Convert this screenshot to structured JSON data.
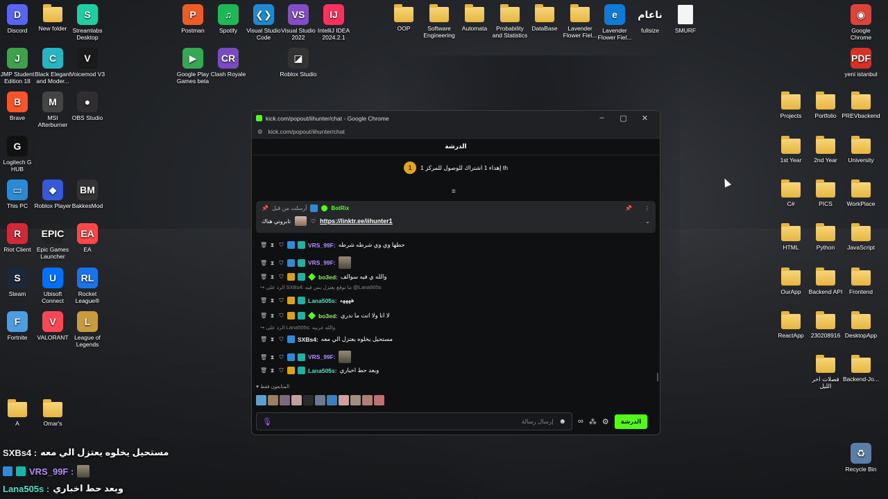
{
  "window": {
    "title": "kick.com/popout/iihunter/chat - Google Chrome",
    "url": "kick.com/popout/iihunter/chat",
    "controls": [
      "–",
      "▢",
      "✕"
    ]
  },
  "chat": {
    "header": "الدرشة",
    "goal_rank": "1",
    "goal_text": "إهداء 1 اشتراك للوصول للمركز 1 th",
    "pinned": {
      "meta": "أرسلت من قبل",
      "bot": "BotRix",
      "link": "https://linktr.ee/iihunter1",
      "label": "تابروني هناك"
    },
    "messages": [
      {
        "user": "VRS_99F:",
        "text": "حطها وي وي شرطه شرطه",
        "color": "purple"
      },
      {
        "user": "VRS_99F:",
        "text": "",
        "color": "purple"
      },
      {
        "user": "bo3ed:",
        "text": "والله ي فيه سوالف",
        "color": "green"
      },
      {
        "user": "Lana505s:",
        "text": "ههههه",
        "color": "teal"
      },
      {
        "user": "bo3ed:",
        "text": "لا انا ولا انت ما ندري",
        "color": "green"
      },
      {
        "user": "SXBs4:",
        "text": "مستحيل يخلوه يعتزل الي معه",
        "color": "white"
      },
      {
        "user": "VRS_99F:",
        "text": "",
        "color": "purple"
      },
      {
        "user": "Lana505s:",
        "text": "وبعد حط اخباري",
        "color": "teal"
      }
    ],
    "replies": [
      "الرد على SXBs4: ما توقع يعتزل بس فيه @Lana505s",
      "الرد على Lana505s: والله عربيه"
    ],
    "viewers_label": "المتابعون فقط",
    "input_placeholder": "إرسال رسالة",
    "send_label": "الدرشة"
  },
  "overlay": [
    {
      "user": "SXBs4 :",
      "text": "مستحيل يخلوه يعتزل الي معه"
    },
    {
      "user": "VRS_99F :",
      "text": ""
    },
    {
      "user": "Lana505s :",
      "text": "وبعد حط اخباري"
    }
  ],
  "desktop": {
    "icons": [
      {
        "label": "Discord",
        "color": "#5865f2",
        "glyph": "D"
      },
      {
        "label": "New folder",
        "type": "folder"
      },
      {
        "label": "Streamlabs Desktop",
        "color": "#1fcfa1",
        "glyph": "S"
      },
      {
        "label": "Postman",
        "color": "#ef5b25",
        "glyph": "P"
      },
      {
        "label": "Spotify",
        "color": "#1db954",
        "glyph": "♫"
      },
      {
        "label": "Visual Studio Code",
        "color": "#1f8ad2",
        "glyph": "❮❯"
      },
      {
        "label": "Visual Studio 2022",
        "color": "#854cc7",
        "glyph": "VS"
      },
      {
        "label": "IntelliJ IDEA 2024.2.1",
        "color": "#fe315d",
        "glyph": "IJ"
      },
      {
        "label": "OOP",
        "type": "folder"
      },
      {
        "label": "Software Engineering",
        "type": "folder"
      },
      {
        "label": "Automata",
        "type": "folder"
      },
      {
        "label": "Probability and Statistics",
        "type": "folder"
      },
      {
        "label": "DataBase",
        "type": "folder"
      },
      {
        "label": "Lavender Flower Fiel...",
        "type": "folder"
      },
      {
        "label": "Lavender Flower Fiel...",
        "color": "#0f7bd8",
        "glyph": "e"
      },
      {
        "label": "fullsize",
        "color": "transparent",
        "glyph": "ناعام"
      },
      {
        "label": "SMURF",
        "type": "doc"
      },
      {
        "label": "Google Chrome",
        "color": "#db4437",
        "glyph": "◉"
      },
      {
        "label": "JMP Student Edition 18",
        "color": "#3fa14b",
        "glyph": "J"
      },
      {
        "label": "Black Elegant and Moder...",
        "color": "#26b5c2",
        "glyph": "C"
      },
      {
        "label": "Voicemod V3",
        "color": "#1a1a1a",
        "glyph": "V"
      },
      {
        "label": "Google Play Games beta",
        "color": "#34a853",
        "glyph": "▶"
      },
      {
        "label": "Clash Royale",
        "color": "#7a4ac2",
        "glyph": "CR"
      },
      {
        "label": "Roblox Studio",
        "color": "#333",
        "glyph": "◪"
      },
      {
        "label": "yeni istanbul",
        "color": "#d93025",
        "glyph": "PDF"
      },
      {
        "label": "Brave",
        "color": "#fb542b",
        "glyph": "B"
      },
      {
        "label": "MSI Afterburner",
        "color": "#444",
        "glyph": "M"
      },
      {
        "label": "OBS Studio",
        "color": "#302e31",
        "glyph": "●"
      },
      {
        "label": "Projects",
        "type": "folder"
      },
      {
        "label": "Portfolio",
        "type": "folder"
      },
      {
        "label": "PREVbackend",
        "type": "folder"
      },
      {
        "label": "Logitech G HUB",
        "color": "#111",
        "glyph": "G"
      },
      {
        "label": "1st Year",
        "type": "folder"
      },
      {
        "label": "2nd Year",
        "type": "folder"
      },
      {
        "label": "University",
        "type": "folder"
      },
      {
        "label": "This PC",
        "color": "#2a8ad4",
        "glyph": "▭"
      },
      {
        "label": "Roblox Player",
        "color": "#3559d8",
        "glyph": "◆"
      },
      {
        "label": "BakkesMod",
        "color": "#333",
        "glyph": "BM"
      },
      {
        "label": "C#",
        "type": "folder"
      },
      {
        "label": "PICS",
        "type": "folder"
      },
      {
        "label": "WorkPlace",
        "type": "folder"
      },
      {
        "label": "Riot Client",
        "color": "#d32936",
        "glyph": "R"
      },
      {
        "label": "Epic Games Launcher",
        "color": "#222",
        "glyph": "EPIC"
      },
      {
        "label": "EA",
        "color": "#ff4747",
        "glyph": "EA"
      },
      {
        "label": "HTML",
        "type": "folder"
      },
      {
        "label": "Python",
        "type": "folder"
      },
      {
        "label": "JavaScript",
        "type": "folder"
      },
      {
        "label": "Steam",
        "color": "#1b2838",
        "glyph": "S"
      },
      {
        "label": "Ubisoft Connect",
        "color": "#0070ff",
        "glyph": "U"
      },
      {
        "label": "Rocket League®",
        "color": "#1a73e8",
        "glyph": "RL"
      },
      {
        "label": "OurApp",
        "type": "folder"
      },
      {
        "label": "Backend API",
        "type": "folder"
      },
      {
        "label": "Frontend",
        "type": "folder"
      },
      {
        "label": "Fortnite",
        "color": "#4d9de0",
        "glyph": "F"
      },
      {
        "label": "VALORANT",
        "color": "#ff4655",
        "glyph": "V"
      },
      {
        "label": "League of Legends",
        "color": "#c89b3c",
        "glyph": "L"
      },
      {
        "label": "ReactApp",
        "type": "folder"
      },
      {
        "label": "230208916",
        "type": "folder"
      },
      {
        "label": "DesktopApp",
        "type": "folder"
      },
      {
        "label": "فصلات اخر الليل",
        "type": "folder"
      },
      {
        "label": "Backend-Jo...",
        "type": "folder"
      },
      {
        "label": "A",
        "type": "folder"
      },
      {
        "label": "Omar's",
        "type": "folder"
      },
      {
        "label": "Recycle Bin",
        "color": "#5a7ea8",
        "glyph": "♻"
      }
    ]
  },
  "colors": {
    "accent": "#53fc18",
    "purple_user": "#b58cff",
    "teal_user": "#4fe0c9"
  }
}
